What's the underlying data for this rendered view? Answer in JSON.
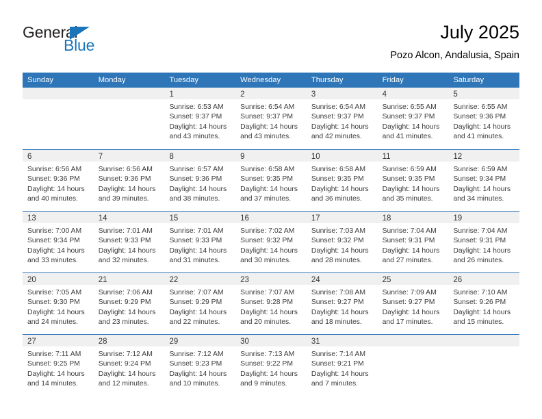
{
  "brand": {
    "name_primary": "General",
    "name_secondary": "Blue",
    "accent_color": "#1b75bb"
  },
  "header": {
    "title": "July 2025",
    "subtitle": "Pozo Alcon, Andalusia, Spain"
  },
  "calendar": {
    "header_bg": "#2e76b8",
    "daynum_bg": "#f0f0f0",
    "weekdays": [
      "Sunday",
      "Monday",
      "Tuesday",
      "Wednesday",
      "Thursday",
      "Friday",
      "Saturday"
    ],
    "weeks": [
      [
        {
          "day": "",
          "lines": []
        },
        {
          "day": "",
          "lines": []
        },
        {
          "day": "1",
          "lines": [
            "Sunrise: 6:53 AM",
            "Sunset: 9:37 PM",
            "Daylight: 14 hours",
            "and 43 minutes."
          ]
        },
        {
          "day": "2",
          "lines": [
            "Sunrise: 6:54 AM",
            "Sunset: 9:37 PM",
            "Daylight: 14 hours",
            "and 43 minutes."
          ]
        },
        {
          "day": "3",
          "lines": [
            "Sunrise: 6:54 AM",
            "Sunset: 9:37 PM",
            "Daylight: 14 hours",
            "and 42 minutes."
          ]
        },
        {
          "day": "4",
          "lines": [
            "Sunrise: 6:55 AM",
            "Sunset: 9:37 PM",
            "Daylight: 14 hours",
            "and 41 minutes."
          ]
        },
        {
          "day": "5",
          "lines": [
            "Sunrise: 6:55 AM",
            "Sunset: 9:36 PM",
            "Daylight: 14 hours",
            "and 41 minutes."
          ]
        }
      ],
      [
        {
          "day": "6",
          "lines": [
            "Sunrise: 6:56 AM",
            "Sunset: 9:36 PM",
            "Daylight: 14 hours",
            "and 40 minutes."
          ]
        },
        {
          "day": "7",
          "lines": [
            "Sunrise: 6:56 AM",
            "Sunset: 9:36 PM",
            "Daylight: 14 hours",
            "and 39 minutes."
          ]
        },
        {
          "day": "8",
          "lines": [
            "Sunrise: 6:57 AM",
            "Sunset: 9:36 PM",
            "Daylight: 14 hours",
            "and 38 minutes."
          ]
        },
        {
          "day": "9",
          "lines": [
            "Sunrise: 6:58 AM",
            "Sunset: 9:35 PM",
            "Daylight: 14 hours",
            "and 37 minutes."
          ]
        },
        {
          "day": "10",
          "lines": [
            "Sunrise: 6:58 AM",
            "Sunset: 9:35 PM",
            "Daylight: 14 hours",
            "and 36 minutes."
          ]
        },
        {
          "day": "11",
          "lines": [
            "Sunrise: 6:59 AM",
            "Sunset: 9:35 PM",
            "Daylight: 14 hours",
            "and 35 minutes."
          ]
        },
        {
          "day": "12",
          "lines": [
            "Sunrise: 6:59 AM",
            "Sunset: 9:34 PM",
            "Daylight: 14 hours",
            "and 34 minutes."
          ]
        }
      ],
      [
        {
          "day": "13",
          "lines": [
            "Sunrise: 7:00 AM",
            "Sunset: 9:34 PM",
            "Daylight: 14 hours",
            "and 33 minutes."
          ]
        },
        {
          "day": "14",
          "lines": [
            "Sunrise: 7:01 AM",
            "Sunset: 9:33 PM",
            "Daylight: 14 hours",
            "and 32 minutes."
          ]
        },
        {
          "day": "15",
          "lines": [
            "Sunrise: 7:01 AM",
            "Sunset: 9:33 PM",
            "Daylight: 14 hours",
            "and 31 minutes."
          ]
        },
        {
          "day": "16",
          "lines": [
            "Sunrise: 7:02 AM",
            "Sunset: 9:32 PM",
            "Daylight: 14 hours",
            "and 30 minutes."
          ]
        },
        {
          "day": "17",
          "lines": [
            "Sunrise: 7:03 AM",
            "Sunset: 9:32 PM",
            "Daylight: 14 hours",
            "and 28 minutes."
          ]
        },
        {
          "day": "18",
          "lines": [
            "Sunrise: 7:04 AM",
            "Sunset: 9:31 PM",
            "Daylight: 14 hours",
            "and 27 minutes."
          ]
        },
        {
          "day": "19",
          "lines": [
            "Sunrise: 7:04 AM",
            "Sunset: 9:31 PM",
            "Daylight: 14 hours",
            "and 26 minutes."
          ]
        }
      ],
      [
        {
          "day": "20",
          "lines": [
            "Sunrise: 7:05 AM",
            "Sunset: 9:30 PM",
            "Daylight: 14 hours",
            "and 24 minutes."
          ]
        },
        {
          "day": "21",
          "lines": [
            "Sunrise: 7:06 AM",
            "Sunset: 9:29 PM",
            "Daylight: 14 hours",
            "and 23 minutes."
          ]
        },
        {
          "day": "22",
          "lines": [
            "Sunrise: 7:07 AM",
            "Sunset: 9:29 PM",
            "Daylight: 14 hours",
            "and 22 minutes."
          ]
        },
        {
          "day": "23",
          "lines": [
            "Sunrise: 7:07 AM",
            "Sunset: 9:28 PM",
            "Daylight: 14 hours",
            "and 20 minutes."
          ]
        },
        {
          "day": "24",
          "lines": [
            "Sunrise: 7:08 AM",
            "Sunset: 9:27 PM",
            "Daylight: 14 hours",
            "and 18 minutes."
          ]
        },
        {
          "day": "25",
          "lines": [
            "Sunrise: 7:09 AM",
            "Sunset: 9:27 PM",
            "Daylight: 14 hours",
            "and 17 minutes."
          ]
        },
        {
          "day": "26",
          "lines": [
            "Sunrise: 7:10 AM",
            "Sunset: 9:26 PM",
            "Daylight: 14 hours",
            "and 15 minutes."
          ]
        }
      ],
      [
        {
          "day": "27",
          "lines": [
            "Sunrise: 7:11 AM",
            "Sunset: 9:25 PM",
            "Daylight: 14 hours",
            "and 14 minutes."
          ]
        },
        {
          "day": "28",
          "lines": [
            "Sunrise: 7:12 AM",
            "Sunset: 9:24 PM",
            "Daylight: 14 hours",
            "and 12 minutes."
          ]
        },
        {
          "day": "29",
          "lines": [
            "Sunrise: 7:12 AM",
            "Sunset: 9:23 PM",
            "Daylight: 14 hours",
            "and 10 minutes."
          ]
        },
        {
          "day": "30",
          "lines": [
            "Sunrise: 7:13 AM",
            "Sunset: 9:22 PM",
            "Daylight: 14 hours",
            "and 9 minutes."
          ]
        },
        {
          "day": "31",
          "lines": [
            "Sunrise: 7:14 AM",
            "Sunset: 9:21 PM",
            "Daylight: 14 hours",
            "and 7 minutes."
          ]
        },
        {
          "day": "",
          "lines": []
        },
        {
          "day": "",
          "lines": []
        }
      ]
    ]
  }
}
